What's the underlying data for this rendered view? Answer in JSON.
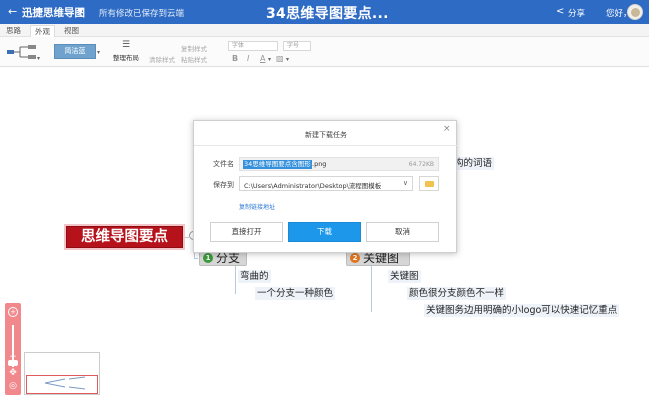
{
  "titlebar": {
    "back_icon": "←",
    "app_name": "迅捷思维导图",
    "app_caret": "▼",
    "save_status": "所有修改已保存到云端",
    "doc_title": "34思维导图要点...",
    "share_icon": "share-icon",
    "share_icon_glyph": "<",
    "share_label": "分享",
    "user_label": "您好，",
    "brand_color": "#2e6bc4"
  },
  "menubar": {
    "items": [
      "思路",
      "外观",
      "视图"
    ]
  },
  "toolbar": {
    "theme_label": "简洁蓝",
    "organize_icon_glyph": "☰",
    "organize_label": "整理布局",
    "clear_style": "清除样式",
    "copy_style": "复制样式",
    "paste_style": "粘贴样式",
    "font_family": "字体",
    "font_size": "字号",
    "bold": "B",
    "italic": "I",
    "text_color": "A",
    "fill_color": "▨",
    "dropdown_caret": "▾"
  },
  "mindmap": {
    "central_topic": "思维导图要点",
    "branches": [
      {
        "num": "1",
        "label": "分支",
        "color": "#3a9b3a"
      },
      {
        "num": "2",
        "label": "关键图",
        "color": "#e3751c"
      }
    ],
    "subtopics": [
      "弯曲的",
      "一个分支一种颜色",
      "关键图",
      "颜色很分支颜色不一样",
      "关键图务边用明确的小logo可以快速记忆重点"
    ],
    "partial_text": "构的词语"
  },
  "zoom": {
    "zoom_in": "+",
    "zoom_out": "−",
    "move": "✥",
    "fit": "◎"
  },
  "dialog": {
    "title": "新建下载任务",
    "close_glyph": "×",
    "filename_label": "文件名",
    "filename_selected": "34思维导图要点含图形",
    "filename_ext": ".png",
    "file_size": "64.72KB",
    "save_to_label": "保存到",
    "save_path": "C:\\Users\\Administrator\\Desktop\\流程图模板",
    "path_caret": "∨",
    "copy_link": "复制链接地址",
    "open_button": "直接打开",
    "download_button": "下载",
    "cancel_button": "取消",
    "primary_color": "#1c97ea"
  }
}
